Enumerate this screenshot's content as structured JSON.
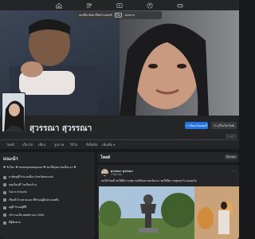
{
  "nav": {
    "icons": [
      "home-icon",
      "friends-icon",
      "watch-icon",
      "groups-icon",
      "gaming-icon"
    ]
  },
  "tooltip": {
    "text": "กดเพื่อกลับมาที่หน้าจอปกติ",
    "key": "Esc",
    "suffix": "ออกจาก"
  },
  "profile": {
    "name": "สุวรรณา สุวรรณา",
    "story_button": "เพิ่มลงในสตอรี่",
    "edit_button": "แก้ไขโปรไฟล์",
    "more_button": "···"
  },
  "tabs": [
    "โพสต์",
    "เกี่ยวกับ",
    "เพื่อน",
    "รูปภาพ",
    "วิดีโอ",
    "ที่เช็คอิน",
    "เพิ่มเติม ▾"
  ],
  "intro": {
    "title": "แนะนำ",
    "bio": "❤ รักใคร ❤ ขอพรคุณพ่อคุณแม่ ❤ ขอให้สุขภาพแข็งแรง ❤",
    "rows": [
      "อาศัยอยู่ที่ อำเภอเมือง จังหวัดขอนแก่น",
      "เคยเรียนที่ โรงเรียนบ้าน",
      "ไปจาก บ้านเกิด",
      "เรียนที่ บ้านสวนนอก ที่บ้านอยู่อีกอำเภอหนึ่ง",
      "อยู่ที่ บ้านอยู่ที่ที่",
      "เข้าร่วมเมื่อ พฤศจิกายน 2554",
      "มีผู้ติดตาม"
    ]
  },
  "posts": {
    "title": "โพสต์",
    "filter": "ตัวกรอง",
    "author": "สุวรรณา สุวรรณา",
    "date": "3 สิงหาคม",
    "menu": "···",
    "text": "ขอให้โชคดี ขอให้มีความสุข ขอให้สุขภาพแข็งแรง ขอให้มีความสุขทุกวัน ปลอดภัย"
  }
}
